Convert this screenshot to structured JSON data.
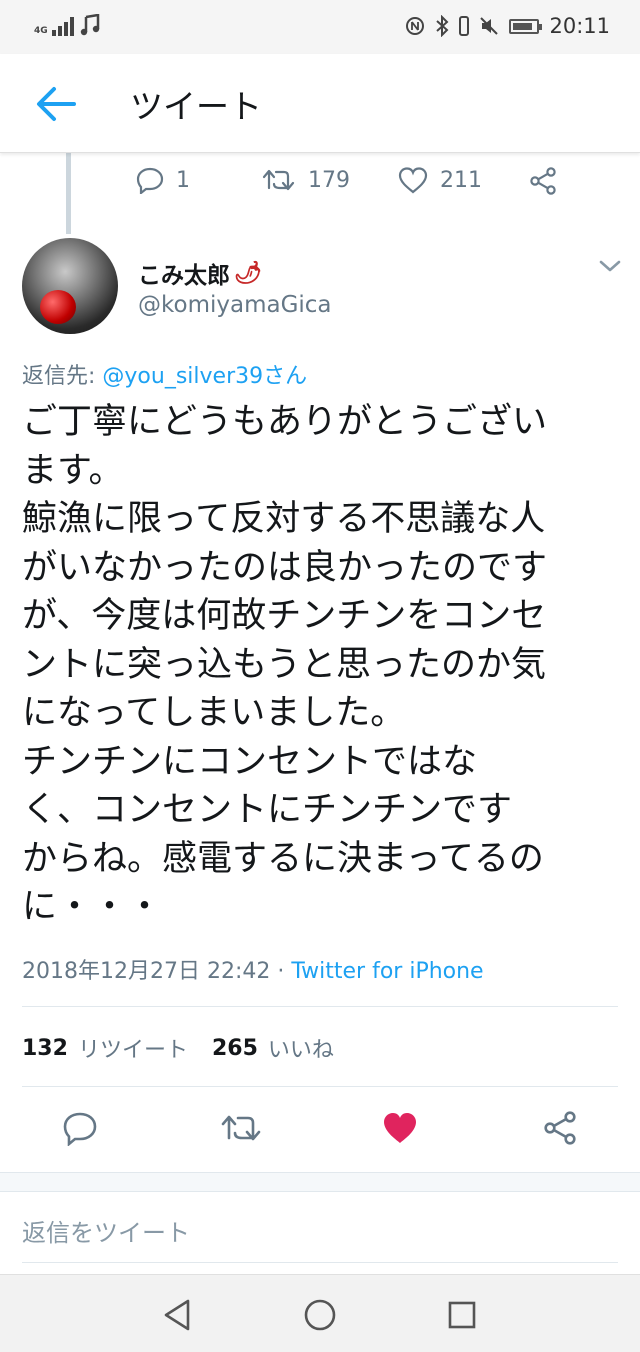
{
  "status_bar": {
    "network": "4G",
    "time": "20:11"
  },
  "header": {
    "title": "ツイート"
  },
  "previous_tweet": {
    "reply_count": "1",
    "retweet_count": "179",
    "like_count": "211"
  },
  "tweet": {
    "display_name": "こみ太郎",
    "name_emoji": "🌶",
    "handle": "@komiyamaGica",
    "reply_prefix": "返信先: ",
    "reply_mention": "@you_silver39さん",
    "text": "ご丁寧にどうもありがとうござい\nます。\n鯨漁に限って反対する不思議な人\nがいなかったのは良かったのです\nが、今度は何故チンチンをコンセ\nントに突っ込もうと思ったのか気\nになってしまいました。\nチンチンにコンセントではな\nく、コンセントにチンチンです\nからね。感電するに決まってるの\nに・・・",
    "timestamp": "2018年12月27日 22:42",
    "separator": " · ",
    "source": "Twitter for iPhone",
    "retweets_number": "132",
    "retweets_label": "リツイート",
    "likes_number": "265",
    "likes_label": "いいね",
    "liked": true
  },
  "reply_box": {
    "placeholder": "返信をツイート"
  },
  "colors": {
    "accent": "#1da1f2",
    "like_active": "#e0245e",
    "muted": "#657786"
  }
}
